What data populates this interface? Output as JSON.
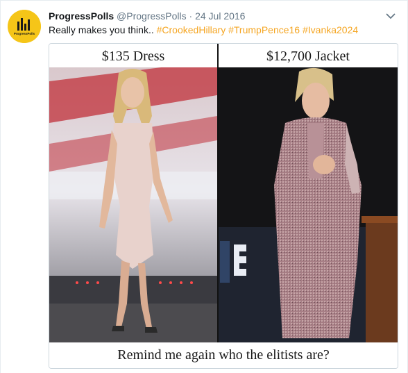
{
  "tweet": {
    "display_name": "ProgressPolls",
    "handle": "@ProgressPolls",
    "separator": "·",
    "timestamp": "24 Jul 2016",
    "text_plain": "Really makes you think.. ",
    "hashtags": [
      "#CrookedHillary",
      "#TrumpPence16",
      "#Ivanka2024"
    ],
    "avatar_logo_text": "ProgressPolls"
  },
  "media": {
    "left_caption": "$135 Dress",
    "right_caption": "$12,700 Jacket",
    "bottom_caption": "Remind me again who the elitists are?"
  },
  "colors": {
    "hashtag": "#f5a623",
    "avatar_bg": "#f5c518",
    "muted_text": "#657786"
  },
  "icons": [
    "chevron-down-icon",
    "progresspolls-logo-icon"
  ]
}
